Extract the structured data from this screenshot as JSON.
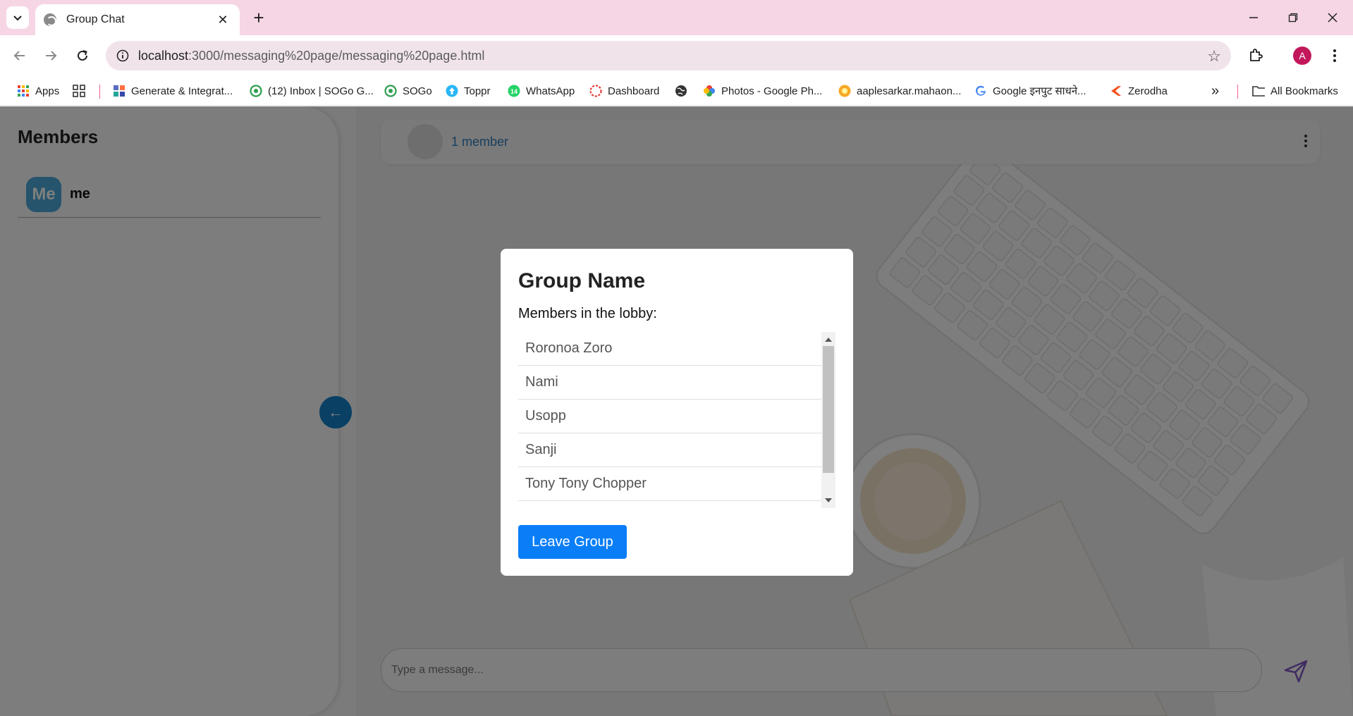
{
  "browser": {
    "tab_title": "Group Chat",
    "url_host": "localhost",
    "url_rest": ":3000/messaging%20page/messaging%20page.html",
    "avatar_letter": "A",
    "bookmarks": [
      {
        "label": "Apps",
        "icon": "apps-grid-icon"
      },
      {
        "label": "",
        "icon": "tab-groups-icon"
      },
      {
        "label": "Generate & Integrat...",
        "icon": "grid-color-icon"
      },
      {
        "label": "(12) Inbox | SOGo G...",
        "icon": "sogo-icon"
      },
      {
        "label": "SOGo",
        "icon": "sogo-icon"
      },
      {
        "label": "Toppr",
        "icon": "toppr-icon"
      },
      {
        "label": "WhatsApp",
        "icon": "whatsapp-icon"
      },
      {
        "label": "Dashboard",
        "icon": "dashboard-icon"
      },
      {
        "label": "",
        "icon": "globe-icon"
      },
      {
        "label": "Photos - Google Ph...",
        "icon": "photos-icon"
      },
      {
        "label": "aaplesarkar.mahaon...",
        "icon": "seal-icon"
      },
      {
        "label": "Google इनपुट साधने...",
        "icon": "google-icon"
      },
      {
        "label": "Zerodha",
        "icon": "zerodha-icon"
      }
    ],
    "all_bookmarks": "All Bookmarks",
    "whatsapp_badge": "14"
  },
  "sidebar": {
    "title": "Members",
    "members": [
      {
        "initials": "Me",
        "name": "me"
      }
    ],
    "collapse_icon": "←"
  },
  "chat": {
    "member_count": "1 member",
    "compose_placeholder": "Type a message..."
  },
  "modal": {
    "title": "Group Name",
    "subtitle": "Members in the lobby:",
    "members": [
      "Roronoa Zoro",
      "Nami",
      "Usopp",
      "Sanji",
      "Tony Tony Chopper"
    ],
    "leave_button": "Leave Group"
  },
  "colors": {
    "tabstrip": "#f6d5e4",
    "accent_blue": "#0a7ef7",
    "member_avatar": "#4aa9d9",
    "profile": "#c2185b"
  }
}
